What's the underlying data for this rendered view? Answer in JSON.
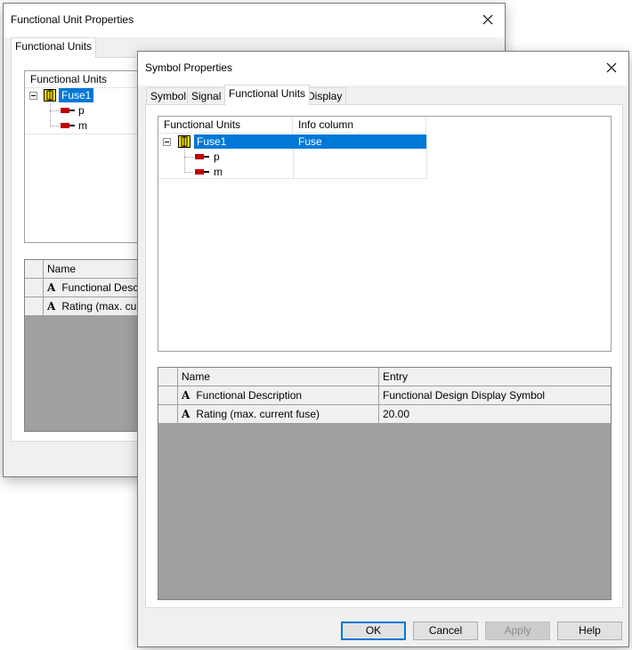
{
  "back_dialog": {
    "title": "Functional Unit Properties",
    "tabs": [
      {
        "label": "Functional Units",
        "active": true
      }
    ],
    "tree": {
      "header": "Functional Units",
      "root": "Fuse1",
      "children": [
        "p",
        "m"
      ]
    },
    "grid": {
      "header_name": "Name",
      "rows": [
        "Functional Desc",
        "Rating (max. cu"
      ]
    }
  },
  "front_dialog": {
    "title": "Symbol Properties",
    "tabs": [
      {
        "label": "Symbol",
        "active": false
      },
      {
        "label": "Signal",
        "active": false
      },
      {
        "label": "Functional Units",
        "active": true
      },
      {
        "label": "Display",
        "active": false
      }
    ],
    "tree": {
      "header_units": "Functional Units",
      "header_info": "Info column",
      "root": {
        "label": "Fuse1",
        "info": "Fuse"
      },
      "children": [
        "p",
        "m"
      ]
    },
    "grid": {
      "header_name": "Name",
      "header_entry": "Entry",
      "rows": [
        {
          "name": "Functional Description",
          "entry": "Functional Design Display Symbol"
        },
        {
          "name": "Rating (max. current fuse)",
          "entry": "20.00"
        }
      ]
    },
    "buttons": {
      "ok": "OK",
      "cancel": "Cancel",
      "apply": "Apply",
      "help": "Help"
    }
  },
  "colors": {
    "selection": "#0078d7",
    "dialog_bg": "#f0f0f0",
    "grid_empty": "#a0a0a0",
    "pin_red": "#c00000"
  },
  "icons": {
    "close": "close-icon",
    "fuse": "fuse-symbol-icon",
    "pin": "pin-icon",
    "attribute": "attribute-A-icon"
  }
}
